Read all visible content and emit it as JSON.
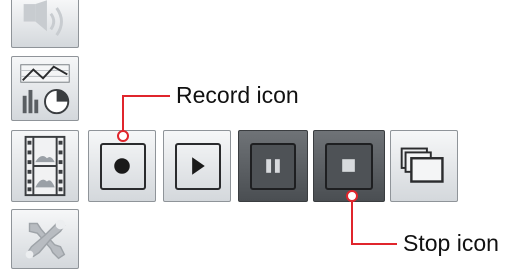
{
  "sidebar": {
    "items": [
      {
        "icon": "speaker-icon"
      },
      {
        "icon": "chart-icon"
      },
      {
        "icon": "film-icon"
      },
      {
        "icon": "tools-icon"
      }
    ]
  },
  "toolbar": {
    "buttons": [
      {
        "icon": "record-icon",
        "state": "normal"
      },
      {
        "icon": "play-icon",
        "state": "normal"
      },
      {
        "icon": "pause-icon",
        "state": "pressed"
      },
      {
        "icon": "stop-icon",
        "state": "pressed"
      },
      {
        "icon": "windows-icon",
        "state": "normal"
      }
    ]
  },
  "callouts": {
    "record_label": "Record icon",
    "stop_label": "Stop icon",
    "line_color": "#e0252c"
  }
}
